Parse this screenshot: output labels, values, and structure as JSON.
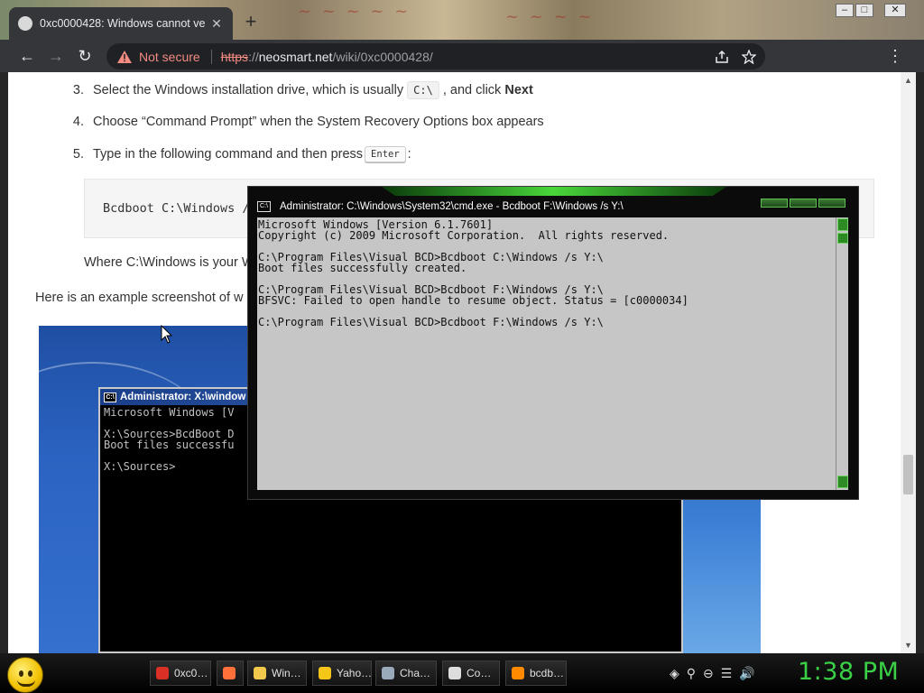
{
  "browser": {
    "tab": {
      "title": "0xc0000428: Windows cannot ve",
      "close": "✕"
    },
    "new_tab": "+",
    "window_controls": {
      "minimize": "–",
      "maximize": "□",
      "close": "✕"
    },
    "nav": {
      "back": "←",
      "forward": "→",
      "reload": "↻"
    },
    "omnibox": {
      "security_label": "Not secure",
      "url_scheme": "https",
      "url_sep": "://",
      "url_host": "neosmart.net",
      "url_path": "/wiki/0xc0000428/"
    },
    "colors": {
      "toolbar": "#35363a",
      "not_secure": "#f28b82"
    }
  },
  "article": {
    "steps": [
      {
        "num": "3.",
        "pre": "Select the Windows installation drive, which is usually",
        "code": "C:\\",
        "mid": ", and click",
        "bold": "Next"
      },
      {
        "num": "4.",
        "text": "Choose “Command Prompt” when the System Recovery Options box appears"
      },
      {
        "num": "5.",
        "pre": "Type in the following command and then press",
        "kbd": "Enter",
        "post": ":"
      }
    ],
    "code_block": "Bcdboot C:\\Windows /",
    "where_text": "Where C:\\Windows is your W",
    "example_text": "Here is an example screenshot of w"
  },
  "screenshot_cmd": {
    "title": "Administrator: X:\\window",
    "lines": [
      "Microsoft Windows [V",
      "",
      "X:\\Sources>BcdBoot D",
      "Boot files successfu",
      "",
      "X:\\Sources>"
    ]
  },
  "cmd_window": {
    "title": "Administrator: C:\\Windows\\System32\\cmd.exe - Bcdboot  F:\\Windows /s Y:\\",
    "lines": [
      "Microsoft Windows [Version 6.1.7601]",
      "Copyright (c) 2009 Microsoft Corporation.  All rights reserved.",
      "",
      "C:\\Program Files\\Visual BCD>Bcdboot C:\\Windows /s Y:\\",
      "Boot files successfully created.",
      "",
      "C:\\Program Files\\Visual BCD>Bcdboot F:\\Windows /s Y:\\",
      "BFSVC: Failed to open handle to resume object. Status = [c0000034]",
      "",
      "C:\\Program Files\\Visual BCD>Bcdboot F:\\Windows /s Y:\\"
    ],
    "accent": "#49d63a"
  },
  "taskbar": {
    "items": [
      {
        "label": "0xc0…",
        "icon": "chrome-icon",
        "color": "#d93025"
      },
      {
        "label": "",
        "icon": "firefox-icon",
        "color": "#ff7139"
      },
      {
        "label": "Win…",
        "icon": "folder-icon",
        "color": "#f2c94c"
      },
      {
        "label": "Yaho…",
        "icon": "yahoo-messenger-icon",
        "color": "#f5c518"
      },
      {
        "label": "Cha…",
        "icon": "chat-people-icon",
        "color": "#9ab"
      },
      {
        "label": "Co…",
        "icon": "console-icon",
        "color": "#ddd"
      },
      {
        "label": "bcdb…",
        "icon": "search-icon",
        "color": "#ff8a00"
      }
    ],
    "tray": [
      "◈",
      "⚲",
      "⊖",
      "☰",
      "🔊"
    ],
    "clock": "1:38 PM",
    "clock_color": "#3bd146"
  }
}
